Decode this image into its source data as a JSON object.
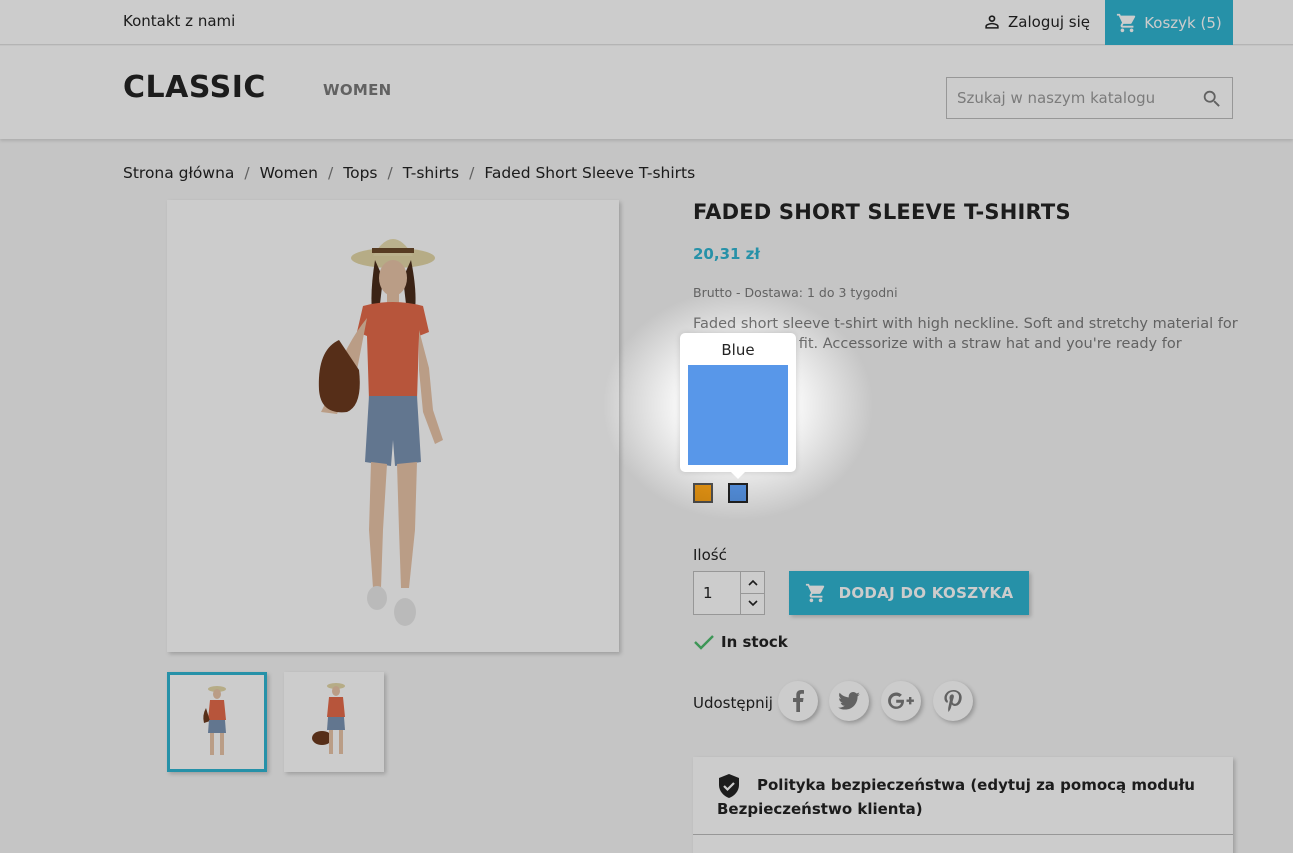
{
  "topbar": {
    "contact": "Kontakt z nami",
    "login": "Zaloguj się",
    "cart": "Koszyk (5)"
  },
  "header": {
    "logo": "CLASSIC",
    "nav_women": "WOMEN",
    "search_placeholder": "Szukaj w naszym katalogu"
  },
  "breadcrumb": [
    "Strona główna",
    "Women",
    "Tops",
    "T-shirts",
    "Faded Short Sleeve T-shirts"
  ],
  "product": {
    "title": "FADED SHORT SLEEVE T-SHIRTS",
    "price": "20,31 zł",
    "tax_info": "Brutto - Dostawa: 1 do 3 tygodni",
    "description": "Faded short sleeve t-shirt with high neckline. Soft and stretchy material for a comfortable fit. Accessorize with a straw hat and you're ready for summer!",
    "quantity_label": "Ilość",
    "quantity_value": "1",
    "add_to_cart": "DODAJ DO KOSZYKA",
    "stock": "In stock",
    "share_label": "Udostępnij",
    "reassurance": "Polityka bezpieczeństwa (edytuj za pomocą modułu Bezpieczeństwo klienta)"
  },
  "colors": [
    {
      "name": "Orange",
      "hex": "#f39d14"
    },
    {
      "name": "Blue",
      "hex": "#5897e9"
    }
  ],
  "tooltip": {
    "label": "Blue",
    "hex": "#5897e9"
  },
  "theme": {
    "accent": "#2fb5d2"
  }
}
